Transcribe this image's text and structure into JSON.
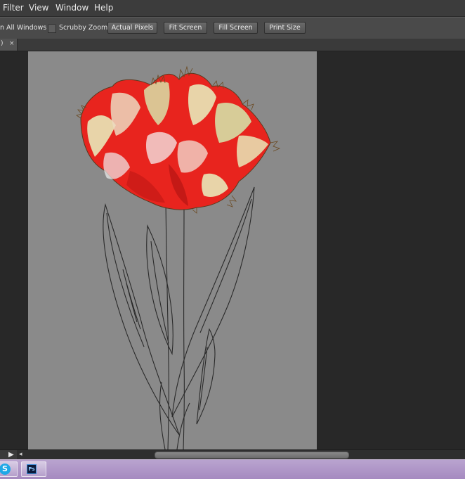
{
  "menu": {
    "items": [
      "Filter",
      "View",
      "Window",
      "Help"
    ]
  },
  "options": {
    "all_windows_label": "n All Windows",
    "scrubby_zoom_label": "Scrubby Zoom",
    "buttons": [
      "Actual Pixels",
      "Fit Screen",
      "Fill Screen",
      "Print Size"
    ]
  },
  "document_tab": {
    "label": ")",
    "close_glyph": "×"
  },
  "scrollbar": {
    "play_glyph": "▶",
    "left_glyph": "◂"
  },
  "taskbar": {
    "skype_glyph": "S",
    "photoshop_glyph": "Ps"
  },
  "colors": {
    "canvas_background": "#8a8a8a",
    "workspace_background": "#282828",
    "taskbar": "#b39bcc",
    "tulip_red": "#e8241e",
    "tulip_cream": "#e8e8b8"
  },
  "icons": [
    "play-icon",
    "arrow-left-icon",
    "skype-icon",
    "photoshop-icon",
    "close-icon"
  ]
}
